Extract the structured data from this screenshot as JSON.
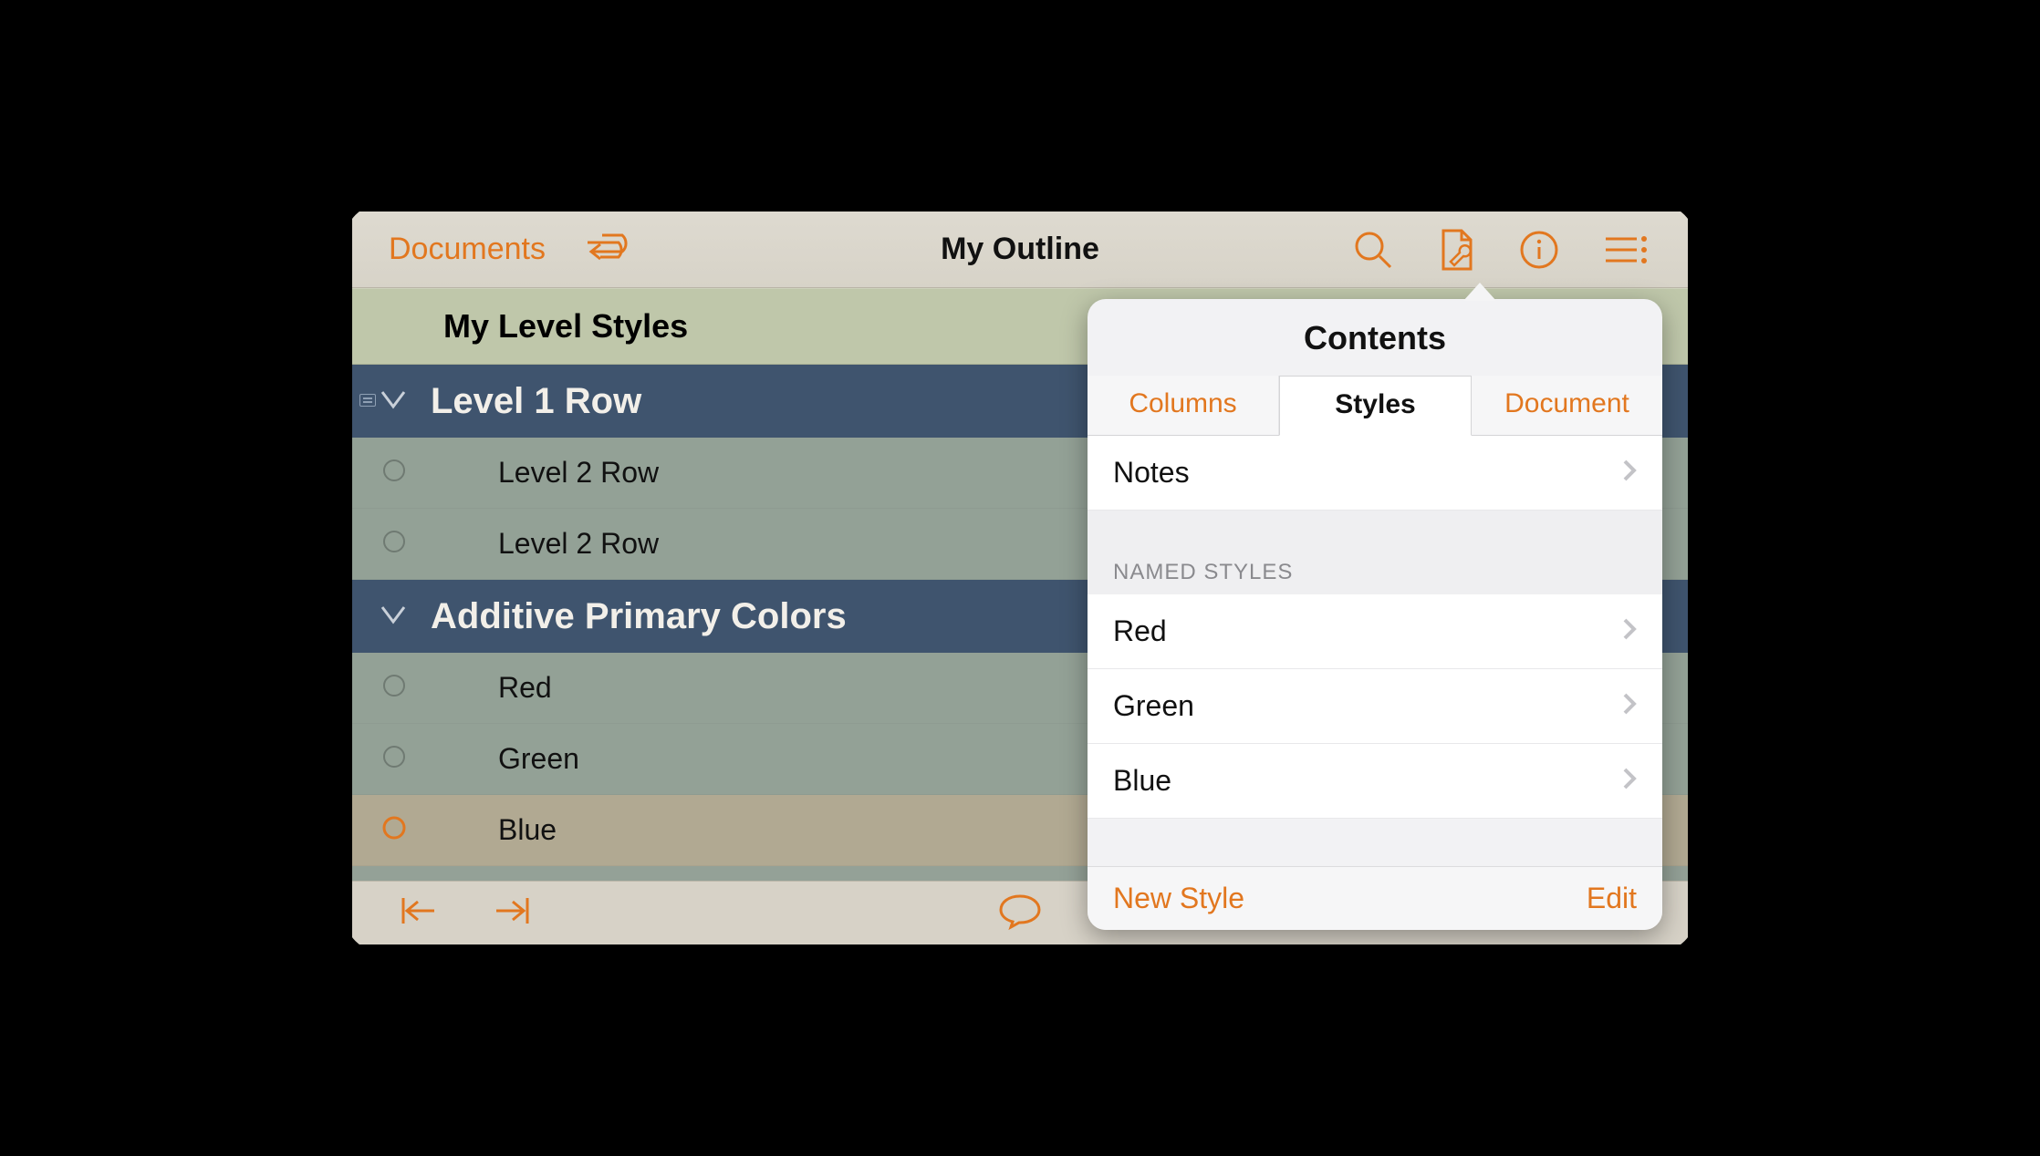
{
  "toolbar": {
    "back_label": "Documents",
    "title": "My Outline"
  },
  "outline": {
    "header": "My Level Styles",
    "rows": [
      {
        "text": "Level 1 Row"
      },
      {
        "text": "Level 2 Row"
      },
      {
        "text": "Level 2 Row"
      },
      {
        "text": "Additive Primary Colors"
      },
      {
        "text": "Red"
      },
      {
        "text": "Green"
      },
      {
        "text": "Blue"
      }
    ]
  },
  "popover": {
    "title": "Contents",
    "tabs": {
      "columns": "Columns",
      "styles": "Styles",
      "document": "Document"
    },
    "notes_label": "Notes",
    "section_header": "NAMED STYLES",
    "named_styles": [
      "Red",
      "Green",
      "Blue"
    ],
    "new_style": "New Style",
    "edit": "Edit"
  }
}
